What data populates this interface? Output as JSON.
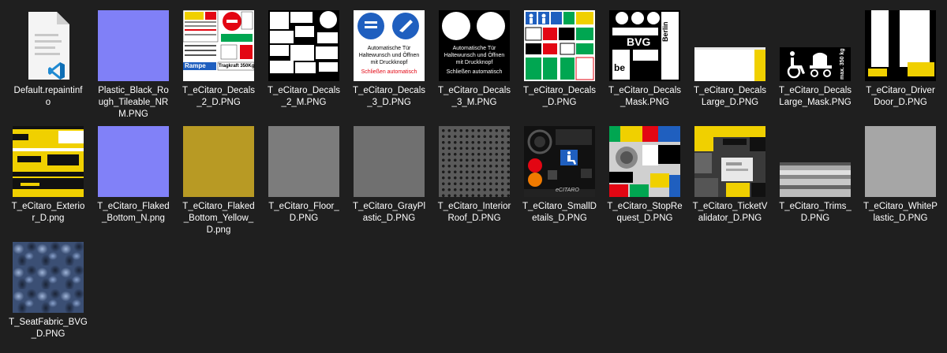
{
  "files": [
    {
      "name": "Default.repaintinfo",
      "lines": [
        "Default.repaintinf",
        "o"
      ],
      "icon": "vscode-file-icon"
    },
    {
      "name": "Plastic_Black_Rough_Tileable_NRM.PNG",
      "lines": [
        "Plastic_Black_Ro",
        "ugh_Tileable_NR",
        "M.PNG"
      ],
      "icon": "normal-map-thumbnail"
    },
    {
      "name": "T_eCitaro_Decals_2_D.PNG",
      "lines": [
        "T_eCitaro_Decals",
        "_2_D.PNG"
      ],
      "icon": "decal-sheet-thumbnail",
      "thumb_texts": {
        "rampe": "Rampe",
        "tragkraft": "Tragkraft 350Kg"
      }
    },
    {
      "name": "T_eCitaro_Decals_2_M.PNG",
      "lines": [
        "T_eCitaro_Decals",
        "_2_M.PNG"
      ],
      "icon": "decal-mask-thumbnail"
    },
    {
      "name": "T_eCitaro_Decals_3_D.PNG",
      "lines": [
        "T_eCitaro_Decals",
        "_3_D.PNG"
      ],
      "icon": "door-sign-thumbnail",
      "thumb_texts": {
        "line1": "Automatische Tür",
        "line2": "Haltewunsch und Öffnen",
        "line3": "mit Druckknopf",
        "line4": "Schließen automatisch"
      }
    },
    {
      "name": "T_eCitaro_Decals_3_M.PNG",
      "lines": [
        "T_eCitaro_Decals",
        "_3_M.PNG"
      ],
      "icon": "door-sign-mask-thumbnail",
      "thumb_texts": {
        "line1": "Automatische Tür",
        "line2": "Haltewunsch und Öffnen",
        "line3": "mit Druckknopf",
        "line4": "Schließen automatisch"
      }
    },
    {
      "name": "T_eCitaro_Decals_D.PNG",
      "lines": [
        "T_eCitaro_Decals",
        "_D.PNG"
      ],
      "icon": "pictogram-sheet-thumbnail"
    },
    {
      "name": "T_eCitaro_Decals_Mask.PNG",
      "lines": [
        "T_eCitaro_Decals",
        "_Mask.PNG"
      ],
      "icon": "bvg-mask-thumbnail",
      "thumb_texts": {
        "bvg": "BVG",
        "berlin": "Berlin",
        "be": "be"
      }
    },
    {
      "name": "T_eCitaro_DecalsLarge_D.PNG",
      "lines": [
        "T_eCitaro_Decals",
        "Large_D.PNG"
      ],
      "icon": "large-decal-thumbnail"
    },
    {
      "name": "T_eCitaro_DecalsLarge_Mask.PNG",
      "lines": [
        "T_eCitaro_Decals",
        "Large_Mask.PNG"
      ],
      "icon": "wheelchair-stroller-thumbnail",
      "thumb_texts": {
        "max": "max. 350 kg"
      }
    },
    {
      "name": "T_eCitaro_DriverDoor_D.PNG",
      "lines": [
        "T_eCitaro_Driver",
        "Door_D.PNG"
      ],
      "icon": "driver-door-thumbnail"
    },
    {
      "name": "T_eCitaro_Exterior_D.png",
      "lines": [
        "T_eCitaro_Exterio",
        "r_D.png"
      ],
      "icon": "exterior-thumbnail"
    },
    {
      "name": "T_eCitaro_Flaked_Bottom_N.png",
      "lines": [
        "T_eCitaro_Flaked",
        "_Bottom_N.png"
      ],
      "icon": "normal-map-thumbnail"
    },
    {
      "name": "T_eCitaro_Flaked_Bottom_Yellow_D.png",
      "lines": [
        "T_eCitaro_Flaked",
        "_Bottom_Yellow_",
        "D.png"
      ],
      "icon": "yellow-texture-thumbnail"
    },
    {
      "name": "T_eCitaro_Floor_D.PNG",
      "lines": [
        "T_eCitaro_Floor_",
        "D.PNG"
      ],
      "icon": "gray-texture-thumbnail"
    },
    {
      "name": "T_eCitaro_GrayPlastic_D.PNG",
      "lines": [
        "T_eCitaro_GrayPl",
        "astic_D.PNG"
      ],
      "icon": "gray-texture-thumbnail"
    },
    {
      "name": "T_eCitaro_InteriorRoof_D.PNG",
      "lines": [
        "T_eCitaro_Interior",
        "Roof_D.PNG"
      ],
      "icon": "perforated-roof-thumbnail"
    },
    {
      "name": "T_eCitaro_SmallDetails_D.PNG",
      "lines": [
        "T_eCitaro_SmallD",
        "etails_D.PNG"
      ],
      "icon": "small-details-thumbnail",
      "thumb_texts": {
        "brand": "eCITARO"
      }
    },
    {
      "name": "T_eCitaro_StopRequest_D.PNG",
      "lines": [
        "T_eCitaro_StopRe",
        "quest_D.PNG"
      ],
      "icon": "stop-request-thumbnail"
    },
    {
      "name": "T_eCitaro_TicketValidator_D.PNG",
      "lines": [
        "T_eCitaro_TicketV",
        "alidator_D.PNG"
      ],
      "icon": "ticket-validator-thumbnail"
    },
    {
      "name": "T_eCitaro_Trims_D.PNG",
      "lines": [
        "T_eCitaro_Trims_",
        "D.PNG"
      ],
      "icon": "trims-thumbnail"
    },
    {
      "name": "T_eCitaro_WhitePlastic_D.PNG",
      "lines": [
        "T_eCitaro_WhiteP",
        "lastic_D.PNG"
      ],
      "icon": "white-plastic-thumbnail"
    },
    {
      "name": "T_SeatFabric_BVG_D.PNG",
      "lines": [
        "T_SeatFabric_BVG",
        "_D.PNG"
      ],
      "icon": "seat-fabric-thumbnail"
    }
  ],
  "colors": {
    "background": "#1f1f1f",
    "text": "#ffffff",
    "normal_map": "#8080ff",
    "bvg_yellow": "#f0d000",
    "sign_blue": "#1f5fbf",
    "sign_red": "#e30613",
    "green": "#00a651"
  }
}
